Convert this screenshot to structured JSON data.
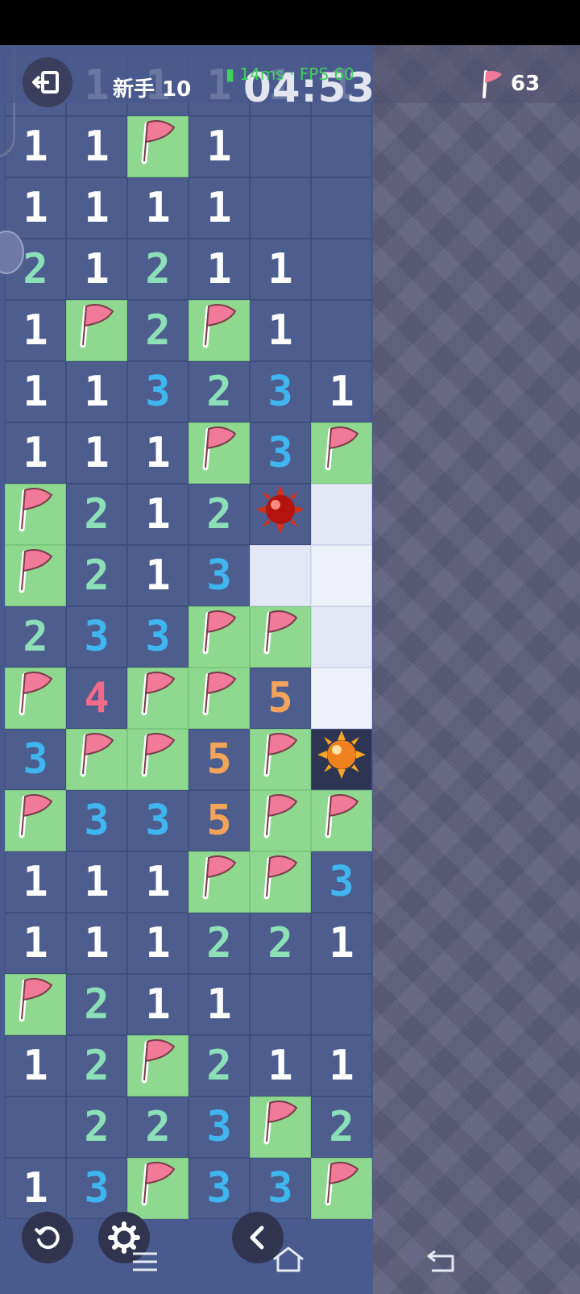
{
  "header": {
    "difficulty": "新手 10",
    "timer": "04:53",
    "network": "14ms · FPS 60",
    "flags_remaining": "63"
  },
  "board": {
    "rows": [
      [
        "",
        "1",
        "1",
        "1",
        "1",
        "1"
      ],
      [
        "1",
        "1",
        "F",
        "1",
        "",
        ""
      ],
      [
        "1",
        "1",
        "1",
        "1",
        "",
        ""
      ],
      [
        "2",
        "1",
        "2",
        "1",
        "1",
        ""
      ],
      [
        "1",
        "F",
        "2",
        "F",
        "1",
        ""
      ],
      [
        "1",
        "1",
        "3",
        "2",
        "3",
        "1"
      ],
      [
        "1",
        "1",
        "1",
        "F",
        "3",
        "F"
      ],
      [
        "F",
        "2",
        "1",
        "2",
        "BOMB_RED",
        "H"
      ],
      [
        "F",
        "2",
        "1",
        "3",
        "H",
        "H2"
      ],
      [
        "2",
        "3",
        "3",
        "F",
        "F",
        "H"
      ],
      [
        "F",
        "4",
        "F",
        "F",
        "5",
        "H2"
      ],
      [
        "3",
        "F",
        "F",
        "5",
        "F",
        "BOMB_ORANGE"
      ],
      [
        "F",
        "3",
        "3",
        "5",
        "F",
        "F"
      ],
      [
        "1",
        "1",
        "1",
        "F",
        "F",
        "3"
      ],
      [
        "1",
        "1",
        "1",
        "2",
        "2",
        "1"
      ],
      [
        "F",
        "2",
        "1",
        "1",
        "",
        ""
      ],
      [
        "1",
        "2",
        "F",
        "2",
        "1",
        "1"
      ],
      [
        "",
        "2",
        "2",
        "3",
        "F",
        "2"
      ],
      [
        "1",
        "3",
        "F",
        "3",
        "3",
        "F"
      ]
    ]
  },
  "colors": {
    "board_bg": "#4d5d8d",
    "flag_cell": "#8ed98f",
    "num1": "#ffffff",
    "num2": "#8ce0b8",
    "num3": "#3fb6f0",
    "num4": "#f06a8a",
    "num5": "#f3a35a"
  },
  "icons": {
    "exit": "exit-icon",
    "flag": "flag-icon",
    "restart": "restart-icon",
    "settings": "gear-icon",
    "back": "chevron-left-icon",
    "nav_menu": "menu-icon",
    "nav_home": "home-icon",
    "nav_back": "back-icon"
  }
}
